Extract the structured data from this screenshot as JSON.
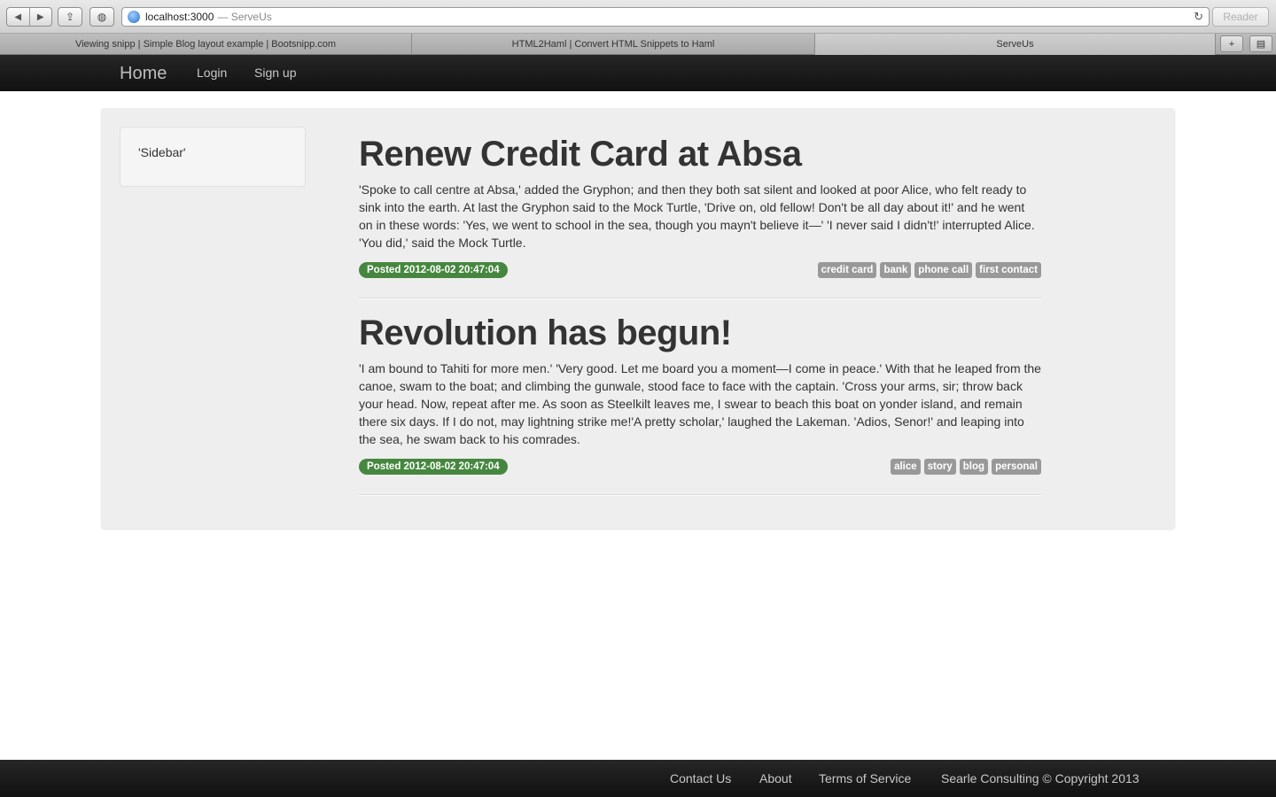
{
  "browser": {
    "url_host": "localhost:3000",
    "url_title": "— ServeUs",
    "reader_label": "Reader",
    "tabs": [
      {
        "label": "Viewing snipp | Simple Blog layout example | Bootsnipp.com"
      },
      {
        "label": "HTML2Haml | Convert HTML Snippets to Haml"
      },
      {
        "label": "ServeUs"
      }
    ]
  },
  "navbar": {
    "brand": "Home",
    "links": [
      "Login",
      "Sign up"
    ]
  },
  "sidebar": {
    "text": "'Sidebar'"
  },
  "posts": [
    {
      "title": "Renew Credit Card at Absa",
      "body": "'Spoke to call centre at Absa,' added the Gryphon; and then they both sat silent and looked at poor Alice, who felt ready to sink into the earth. At last the Gryphon said to the Mock Turtle, 'Drive on, old fellow! Don't be all day about it!' and he went on in these words: 'Yes, we went to school in the sea, though you mayn't believe it—' 'I never said I didn't!' interrupted Alice. 'You did,' said the Mock Turtle.",
      "posted": "Posted 2012-08-02 20:47:04",
      "tags": [
        "credit card",
        "bank",
        "phone call",
        "first contact"
      ]
    },
    {
      "title": "Revolution has begun!",
      "body": "'I am bound to Tahiti for more men.' 'Very good. Let me board you a moment—I come in peace.' With that he leaped from the canoe, swam to the boat; and climbing the gunwale, stood face to face with the captain. 'Cross your arms, sir; throw back your head. Now, repeat after me. As soon as Steelkilt leaves me, I swear to beach this boat on yonder island, and remain there six days. If I do not, may lightning strike me!'A pretty scholar,' laughed the Lakeman. 'Adios, Senor!' and leaping into the sea, he swam back to his comrades.",
      "posted": "Posted 2012-08-02 20:47:04",
      "tags": [
        "alice",
        "story",
        "blog",
        "personal"
      ]
    }
  ],
  "footer": {
    "links": [
      "Contact Us",
      "About",
      "Terms of Service"
    ],
    "copyright": "Searle Consulting © Copyright 2013"
  },
  "colors": {
    "posted_badge": "#46873f",
    "tag_badge": "#999999",
    "navbar": "#1b1b1b",
    "container": "#eeeeee"
  }
}
